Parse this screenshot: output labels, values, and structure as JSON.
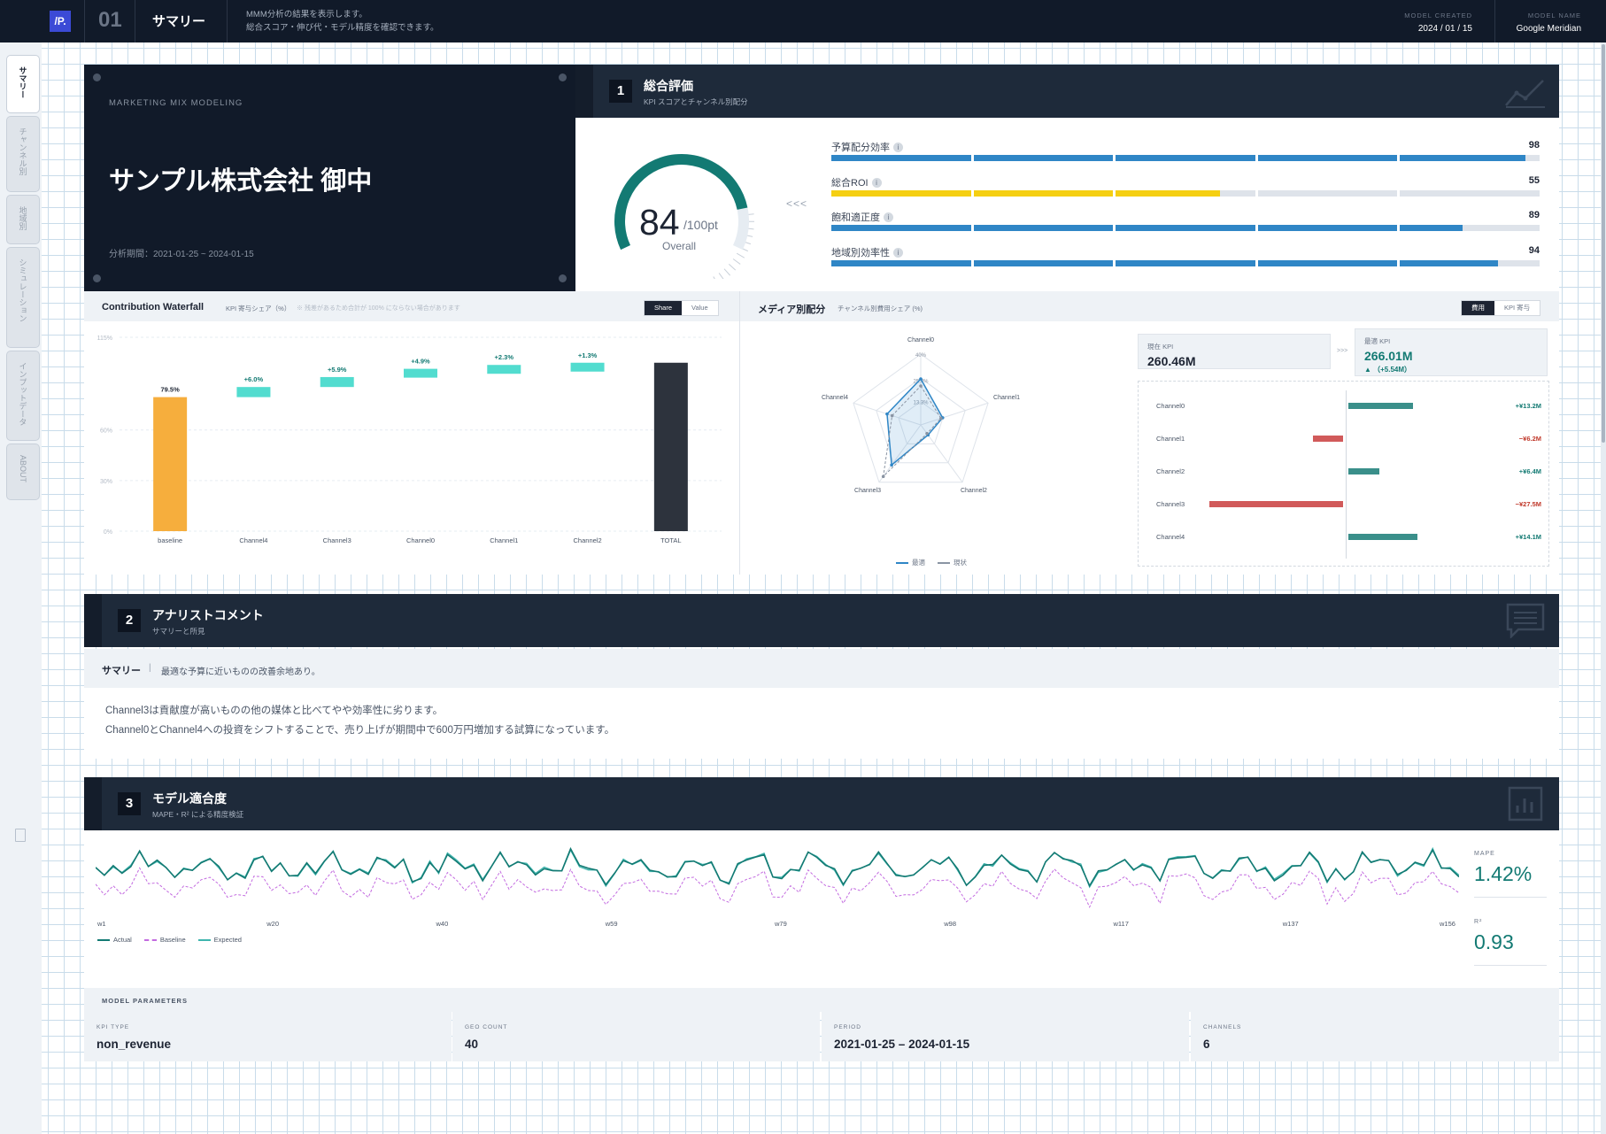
{
  "header": {
    "logo": "/P.",
    "page_number": "01",
    "page_title": "サマリー",
    "desc_line1": "MMM分析の結果を表示します。",
    "desc_line2": "総合スコア・伸び代・モデル精度を確認できます。",
    "model_created_label": "MODEL CREATED",
    "model_created_value": "2024 / 01 / 15",
    "model_name_label": "MODEL NAME",
    "model_name_value": "Google Meridian"
  },
  "sidebar": {
    "tabs": [
      {
        "label": "サマリー",
        "active": true
      },
      {
        "label": "チャンネル別",
        "active": false
      },
      {
        "label": "地域別",
        "active": false
      },
      {
        "label": "シミュレーション",
        "active": false
      },
      {
        "label": "インプットデータ",
        "active": false
      },
      {
        "label": "ABOUT",
        "active": false
      }
    ]
  },
  "hero": {
    "kicker": "MARKETING MIX MODELING",
    "client": "サンプル株式会社 御中",
    "period": "分析期間：2021-01-25 ~ 2024-01-15"
  },
  "section1": {
    "num": "1",
    "title": "総合評価",
    "subtitle": "KPI スコアとチャンネル別配分",
    "score": "84",
    "score_unit": "/100pt",
    "score_label": "Overall",
    "score_value": 84,
    "arrows": "<<<",
    "metrics": [
      {
        "label": "予算配分効率",
        "value": "98",
        "level": 98,
        "color": "#2f86c6"
      },
      {
        "label": "総合ROI",
        "value": "55",
        "level": 55,
        "color": "#f5cf12"
      },
      {
        "label": "飽和適正度",
        "value": "89",
        "level": 89,
        "color": "#2f86c6"
      },
      {
        "label": "地域別効率性",
        "value": "94",
        "level": 94,
        "color": "#2f86c6"
      }
    ]
  },
  "waterfall": {
    "title": "Contribution Waterfall",
    "subtitle": "KPI 寄与シェア（%）",
    "note": "※ 残差があるため合計が 100% にならない場合があります",
    "toggle_on": "Share",
    "toggle_off": "Value"
  },
  "media": {
    "title": "メディア別配分",
    "subtitle": "チャンネル別費用シェア (%)",
    "toggle_on": "費用",
    "toggle_off": "KPI 寄与",
    "current_kpi_label": "現在 KPI",
    "current_kpi_value": "260.46M",
    "arrow": ">>>",
    "optimal_kpi_label": "最適 KPI",
    "optimal_kpi_value": "266.01M",
    "optimal_kpi_delta": "▲ （+5.54M）",
    "legend_optimal": "最適",
    "legend_current": "現状",
    "changes": [
      {
        "name": "Channel0",
        "value": "+¥13.2M",
        "amount": 13.2
      },
      {
        "name": "Channel1",
        "value": "−¥6.2M",
        "amount": -6.2
      },
      {
        "name": "Channel2",
        "value": "+¥6.4M",
        "amount": 6.4
      },
      {
        "name": "Channel3",
        "value": "−¥27.5M",
        "amount": -27.5
      },
      {
        "name": "Channel4",
        "value": "+¥14.1M",
        "amount": 14.1
      }
    ]
  },
  "chart_data": [
    {
      "type": "bar",
      "title": "Contribution Waterfall",
      "categories": [
        "baseline",
        "Channel4",
        "Channel3",
        "Channel0",
        "Channel1",
        "Channel2",
        "TOTAL"
      ],
      "values": [
        79.5,
        6.0,
        5.9,
        4.9,
        2.3,
        1.3,
        99.9
      ],
      "labels": [
        "79.5%",
        "+6.0%",
        "+5.9%",
        "+4.9%",
        "+2.3%",
        "+1.3%",
        ""
      ],
      "yticks": [
        "0%",
        "30%",
        "60%",
        "115%"
      ],
      "ylim": [
        0,
        115
      ],
      "colors": {
        "baseline": "#f6ae3d",
        "increment": "#52dccf",
        "total": "#2d333d"
      }
    },
    {
      "type": "radar",
      "axes": [
        "Channel0",
        "Channel1",
        "Channel2",
        "Channel3",
        "Channel4"
      ],
      "rticks": [
        "40%",
        "25.4%",
        "13.3%"
      ],
      "rmax": 40,
      "series": [
        {
          "name": "最適",
          "values": [
            26,
            13,
            7,
            28,
            20
          ],
          "color": "#2f86c6"
        },
        {
          "name": "現状",
          "values": [
            22,
            12,
            6,
            36,
            17
          ],
          "color": "#8a94a3"
        }
      ]
    },
    {
      "type": "line",
      "x_ticks": [
        "w1",
        "w20",
        "w40",
        "w59",
        "w79",
        "w98",
        "w117",
        "w137",
        "w156"
      ],
      "series": [
        {
          "name": "Actual",
          "color": "#137a73"
        },
        {
          "name": "Baseline",
          "color": "#c36be0"
        },
        {
          "name": "Expected",
          "color": "#3fb5ae"
        }
      ]
    }
  ],
  "section2": {
    "num": "2",
    "title": "アナリストコメント",
    "subtitle": "サマリーと所見",
    "summary_label": "サマリー",
    "summary_sep": "|",
    "summary_text": "最適な予算に近いものの改善余地あり。",
    "line1": "Channel3は貢献度が高いものの他の媒体と比べてやや効率性に劣ります。",
    "line2": "Channel0とChannel4への投資をシフトすることで、売り上げが期間中で600万円増加する試算になっています。"
  },
  "section3": {
    "num": "3",
    "title": "モデル適合度",
    "subtitle": "MAPE・R² による精度検証",
    "legend": [
      "Actual",
      "Baseline",
      "Expected"
    ],
    "mape_label": "MAPE",
    "mape_value": "1.42%",
    "r2_label": "R²",
    "r2_value": "0.93"
  },
  "params": {
    "title": "MODEL PARAMETERS",
    "items": [
      {
        "label": "KPI TYPE",
        "value": "non_revenue"
      },
      {
        "label": "GEO COUNT",
        "value": "40"
      },
      {
        "label": "PERIOD",
        "value": "2021-01-25 – 2024-01-15"
      },
      {
        "label": "CHANNELS",
        "value": "6"
      }
    ]
  }
}
